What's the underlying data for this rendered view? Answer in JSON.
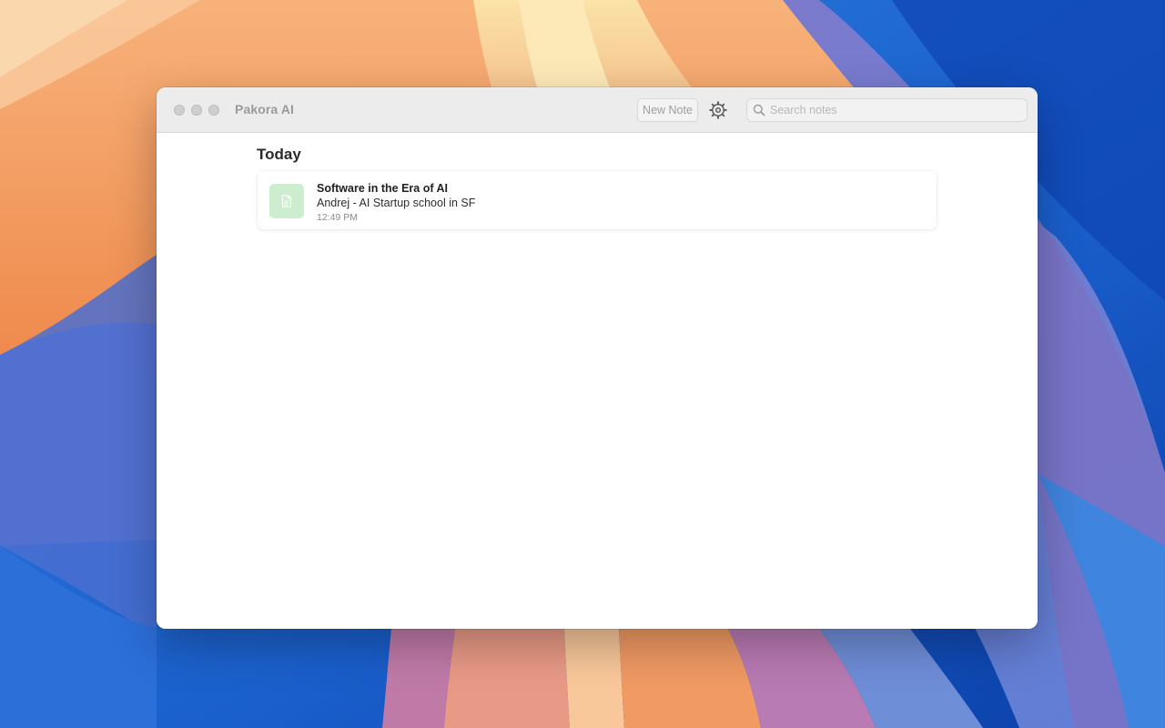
{
  "window": {
    "app_title": "Pakora AI"
  },
  "toolbar": {
    "new_note_label": "New Note",
    "settings_icon": "gear-icon",
    "search": {
      "placeholder": "Search notes",
      "value": "",
      "icon": "search-icon"
    }
  },
  "notes_list": {
    "section_heading": "Today",
    "items": [
      {
        "title": "Software in the Era of AI",
        "subtitle": "Andrej - AI Startup school in SF",
        "time": "12:49 PM",
        "icon": "document-icon"
      }
    ]
  },
  "colors": {
    "note_icon_bg": "#cdeece",
    "titlebar_bg": "#ececec",
    "window_bg": "#ffffff"
  }
}
